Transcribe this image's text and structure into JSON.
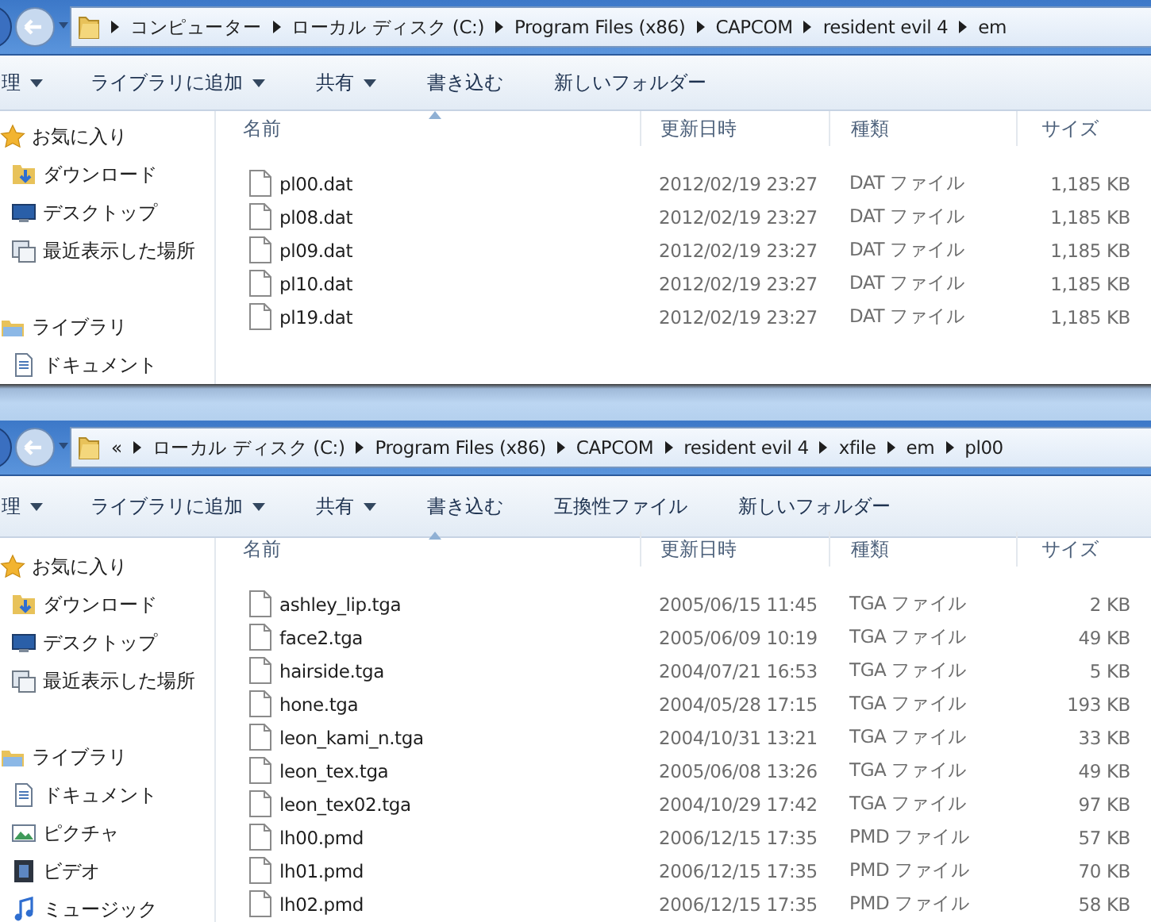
{
  "windows": [
    {
      "address": {
        "crumbs": [
          "コンピューター",
          "ローカル ディスク (C:)",
          "Program Files (x86)",
          "CAPCOM",
          "resident evil 4",
          "em"
        ],
        "lead_arrow": true
      },
      "toolbar": [
        {
          "label": "理",
          "dropdown": true
        },
        {
          "label": "ライブラリに追加",
          "dropdown": true
        },
        {
          "label": "共有",
          "dropdown": true
        },
        {
          "label": "書き込む",
          "dropdown": false
        },
        {
          "label": "新しいフォルダー",
          "dropdown": false
        }
      ],
      "columns": [
        {
          "label": "名前",
          "sorted": true
        },
        {
          "label": "更新日時",
          "sorted": false
        },
        {
          "label": "種類",
          "sorted": false
        },
        {
          "label": "サイズ",
          "sorted": false
        }
      ],
      "sidebar": [
        {
          "label": "お気に入り",
          "kind": "star",
          "children": [
            {
              "label": "ダウンロード",
              "kind": "download"
            },
            {
              "label": "デスクトップ",
              "kind": "desktop"
            },
            {
              "label": "最近表示した場所",
              "kind": "recent"
            }
          ]
        },
        {
          "label": "ライブラリ",
          "kind": "library",
          "children": [
            {
              "label": "ドキュメント",
              "kind": "document"
            }
          ]
        }
      ],
      "files": [
        {
          "name": "pl00.dat",
          "date": "2012/02/19 23:27",
          "type": "DAT ファイル",
          "size": "1,185 KB"
        },
        {
          "name": "pl08.dat",
          "date": "2012/02/19 23:27",
          "type": "DAT ファイル",
          "size": "1,185 KB"
        },
        {
          "name": "pl09.dat",
          "date": "2012/02/19 23:27",
          "type": "DAT ファイル",
          "size": "1,185 KB"
        },
        {
          "name": "pl10.dat",
          "date": "2012/02/19 23:27",
          "type": "DAT ファイル",
          "size": "1,185 KB"
        },
        {
          "name": "pl19.dat",
          "date": "2012/02/19 23:27",
          "type": "DAT ファイル",
          "size": "1,185 KB"
        }
      ]
    },
    {
      "address": {
        "crumbs": [
          "«",
          "ローカル ディスク (C:)",
          "Program Files (x86)",
          "CAPCOM",
          "resident evil 4",
          "xfile",
          "em",
          "pl00"
        ],
        "lead_arrow": false
      },
      "toolbar": [
        {
          "label": "理",
          "dropdown": true
        },
        {
          "label": "ライブラリに追加",
          "dropdown": true
        },
        {
          "label": "共有",
          "dropdown": true
        },
        {
          "label": "書き込む",
          "dropdown": false
        },
        {
          "label": "互換性ファイル",
          "dropdown": false
        },
        {
          "label": "新しいフォルダー",
          "dropdown": false
        }
      ],
      "columns": [
        {
          "label": "名前",
          "sorted": true
        },
        {
          "label": "更新日時",
          "sorted": false
        },
        {
          "label": "種類",
          "sorted": false
        },
        {
          "label": "サイズ",
          "sorted": false
        }
      ],
      "sidebar": [
        {
          "label": "お気に入り",
          "kind": "star",
          "children": [
            {
              "label": "ダウンロード",
              "kind": "download"
            },
            {
              "label": "デスクトップ",
              "kind": "desktop"
            },
            {
              "label": "最近表示した場所",
              "kind": "recent"
            }
          ]
        },
        {
          "label": "ライブラリ",
          "kind": "library",
          "children": [
            {
              "label": "ドキュメント",
              "kind": "document"
            },
            {
              "label": "ピクチャ",
              "kind": "picture"
            },
            {
              "label": "ビデオ",
              "kind": "video"
            },
            {
              "label": "ミュージック",
              "kind": "music"
            }
          ]
        }
      ],
      "files": [
        {
          "name": "ashley_lip.tga",
          "date": "2005/06/15 11:45",
          "type": "TGA ファイル",
          "size": "2 KB"
        },
        {
          "name": "face2.tga",
          "date": "2005/06/09 10:19",
          "type": "TGA ファイル",
          "size": "49 KB"
        },
        {
          "name": "hairside.tga",
          "date": "2004/07/21 16:53",
          "type": "TGA ファイル",
          "size": "5 KB"
        },
        {
          "name": "hone.tga",
          "date": "2004/05/28 17:15",
          "type": "TGA ファイル",
          "size": "193 KB"
        },
        {
          "name": "leon_kami_n.tga",
          "date": "2004/10/31 13:21",
          "type": "TGA ファイル",
          "size": "33 KB"
        },
        {
          "name": "leon_tex.tga",
          "date": "2005/06/08 13:26",
          "type": "TGA ファイル",
          "size": "49 KB"
        },
        {
          "name": "leon_tex02.tga",
          "date": "2004/10/29 17:42",
          "type": "TGA ファイル",
          "size": "97 KB"
        },
        {
          "name": "lh00.pmd",
          "date": "2006/12/15 17:35",
          "type": "PMD ファイル",
          "size": "57 KB"
        },
        {
          "name": "lh01.pmd",
          "date": "2006/12/15 17:35",
          "type": "PMD ファイル",
          "size": "70 KB"
        },
        {
          "name": "lh02.pmd",
          "date": "2006/12/15 17:35",
          "type": "PMD ファイル",
          "size": "58 KB"
        }
      ]
    }
  ]
}
